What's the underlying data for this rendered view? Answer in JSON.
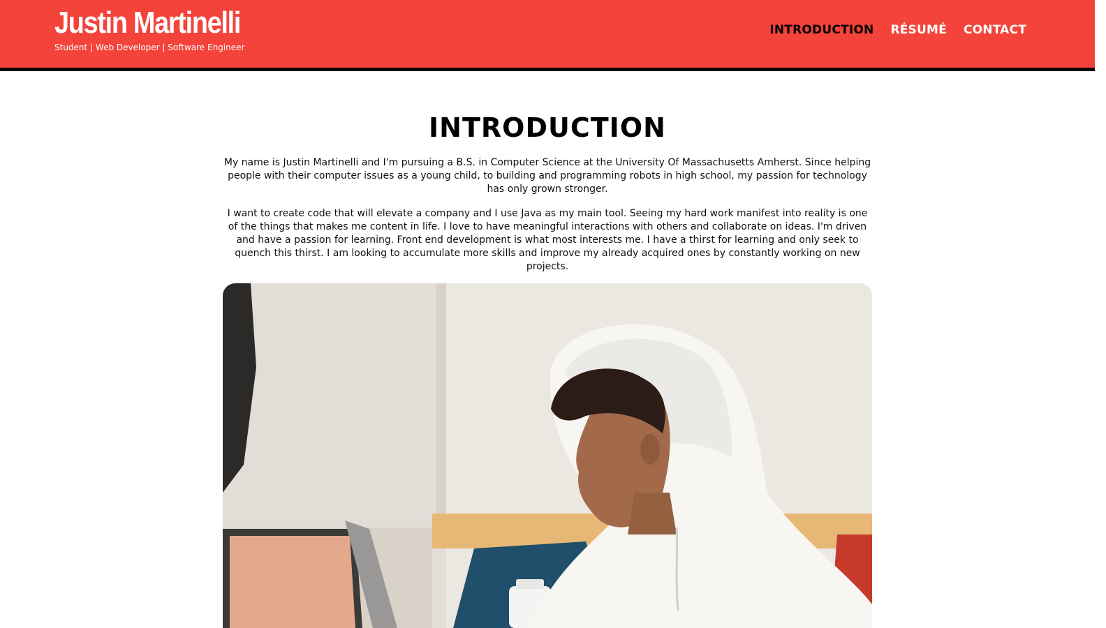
{
  "header": {
    "name": "Justin Martinelli",
    "tagline": "Student | Web Developer | Software Engineer",
    "accent_color": "#f4433a",
    "nav": [
      {
        "label": "INTRODUCTION",
        "active": true
      },
      {
        "label": "RÉSUMÉ",
        "active": false
      },
      {
        "label": "CONTACT",
        "active": false
      }
    ]
  },
  "main": {
    "title": "INTRODUCTION",
    "paragraphs": [
      "My name is Justin Martinelli and I'm pursuing a B.S. in Computer Science at the University Of Massachusetts Amherst. Since helping people with their computer issues as a young child, to building and programming robots in high school, my passion for technology has only grown stronger.",
      "I want to create code that will elevate a company and I use Java as my main tool. Seeing my hard work manifest into reality is one of the things that makes me content in life. I love to have meaningful interactions with others and collaborate on ideas. I'm driven and have a passion for learning. Front end development is what most interests me. I have a thirst for learning and only seek to quench this thirst. I am looking to accumulate more skills and improve my already acquired ones by constantly working on new projects."
    ],
    "photo": {
      "icon": "profile-photo"
    }
  }
}
